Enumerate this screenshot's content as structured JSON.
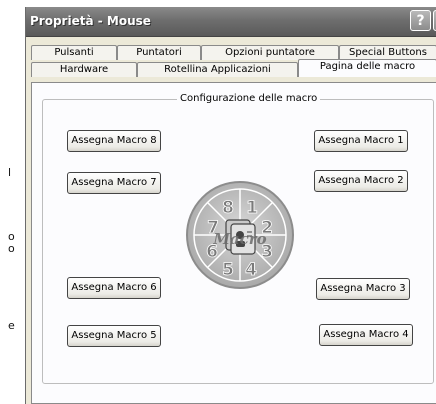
{
  "side": {
    "text1": "l",
    "text2": "o",
    "text3": "o",
    "text4": "e"
  },
  "window": {
    "title": "Proprietà - Mouse",
    "help_label": "?",
    "tabs_row1": [
      "Pulsanti",
      "Puntatori",
      "Opzioni puntatore",
      "Special Buttons"
    ],
    "tabs_row2": [
      "Hardware",
      "Rotellina Applicazioni",
      "Pagina delle macro"
    ],
    "active_tab": "Pagina delle macro"
  },
  "group": {
    "label": "Configurazione delle macro"
  },
  "buttons": {
    "m1": "Assegna Macro 1",
    "m2": "Assegna Macro 2",
    "m3": "Assegna Macro 3",
    "m4": "Assegna Macro 4",
    "m5": "Assegna Macro 5",
    "m6": "Assegna Macro 6",
    "m7": "Assegna Macro 7",
    "m8": "Assegna Macro 8"
  },
  "dial": {
    "numbers": [
      "1",
      "2",
      "3",
      "4",
      "5",
      "6",
      "7",
      "8"
    ],
    "logo_text": "Macro"
  }
}
